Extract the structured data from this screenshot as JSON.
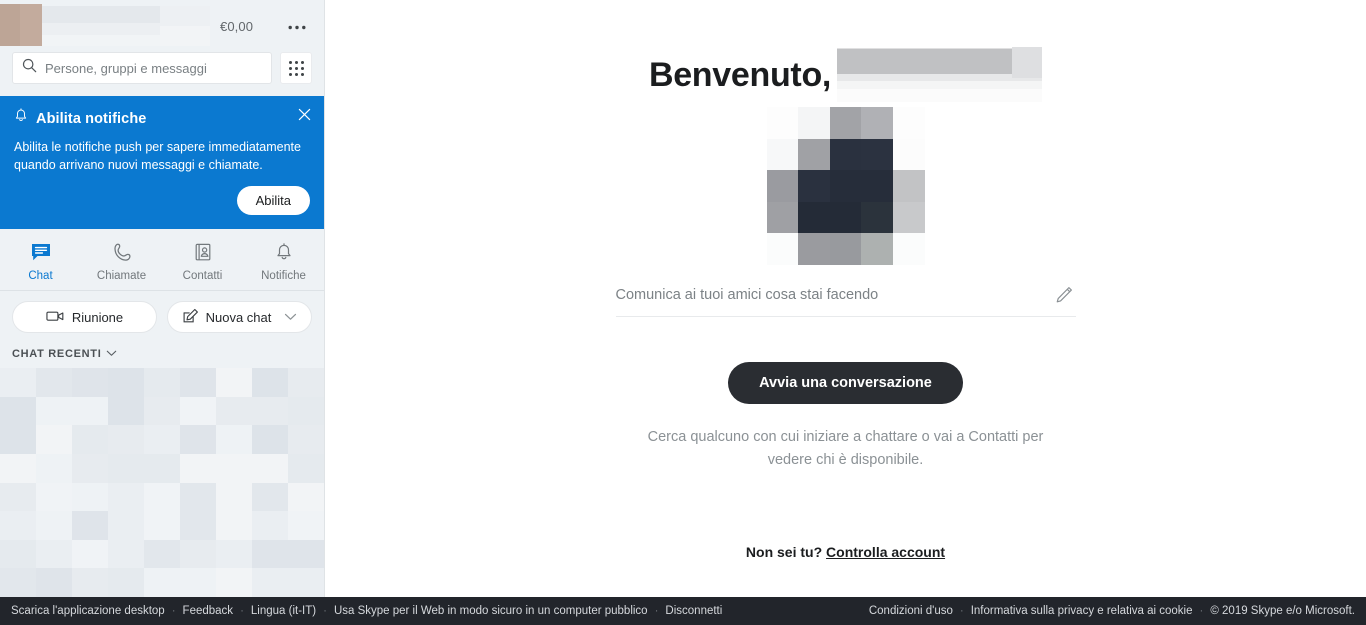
{
  "sidebar": {
    "balance": "€0,00",
    "more_label": "•••",
    "search": {
      "placeholder": "Persone, gruppi e messaggi",
      "value": ""
    },
    "notification": {
      "title": "Abilita notifiche",
      "body": "Abilita le notifiche push per sapere immediatamente quando arrivano nuovi messaggi e chiamate.",
      "button": "Abilita",
      "close_label": "✕",
      "bg_color": "#0b79d0"
    },
    "tabs": [
      {
        "label": "Chat",
        "icon": "chat-icon",
        "active": true
      },
      {
        "label": "Chiamate",
        "icon": "phone-icon",
        "active": false
      },
      {
        "label": "Contatti",
        "icon": "contacts-icon",
        "active": false
      },
      {
        "label": "Notifiche",
        "icon": "bell-icon",
        "active": false
      }
    ],
    "actions": [
      {
        "label": "Riunione",
        "icon": "video-camera-icon"
      },
      {
        "label": "Nuova chat",
        "icon": "compose-icon",
        "has_chevron": true
      }
    ],
    "recent_header": "CHAT RECENTI"
  },
  "main": {
    "greeting": "Benvenuto,",
    "mood_placeholder": "Comunica ai tuoi amici cosa stai facendo",
    "cta_label": "Avvia una conversazione",
    "hint": "Cerca qualcuno con cui iniziare a chattare o vai a Contatti per vedere chi è disponibile.",
    "not_you_text": "Non sei tu?",
    "check_account_link": "Controlla account"
  },
  "statusbar": {
    "left": [
      "Scarica l'applicazione desktop",
      "Feedback",
      "Lingua (it-IT)",
      "Usa Skype per il Web in modo sicuro in un computer pubblico",
      "Disconnetti"
    ],
    "right": [
      "Condizioni d'uso",
      "Informativa sulla privacy e relativa ai cookie",
      "© 2019 Skype e/o Microsoft."
    ],
    "separator": "·",
    "bg_color": "#22252b"
  },
  "theme": {
    "accent": "#0b79d0",
    "sidebar_bg": "#eef2f5",
    "cta_bg": "#2a2d32"
  }
}
